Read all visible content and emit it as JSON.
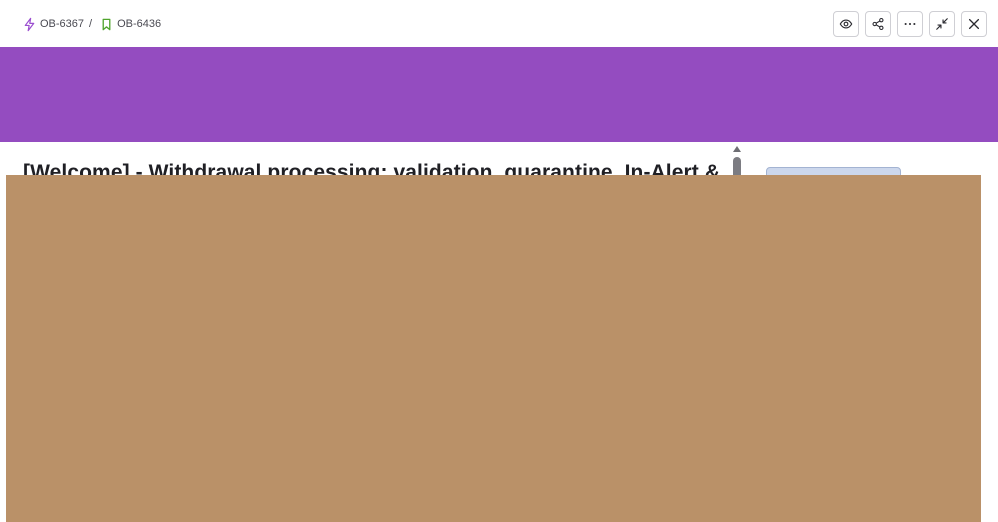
{
  "breadcrumb": {
    "parent_key": "OB-6367",
    "separator": "/",
    "current_key": "OB-6436"
  },
  "issue": {
    "title": "[Welcome] - Withdrawal processing: validation, quarantine, In-Alert &"
  },
  "colors": {
    "banner": "#944cc0",
    "overlay": "#ba9168",
    "parent_icon": "#9b4fd0",
    "current_icon": "#4fa42c",
    "status_chip": "#ccd7ec"
  },
  "icons": {
    "parent": "lightning-icon",
    "current": "bookmark-icon",
    "actions": [
      "eye-icon",
      "share-icon",
      "more-horizontal-icon",
      "collapse-icon",
      "close-icon"
    ]
  }
}
